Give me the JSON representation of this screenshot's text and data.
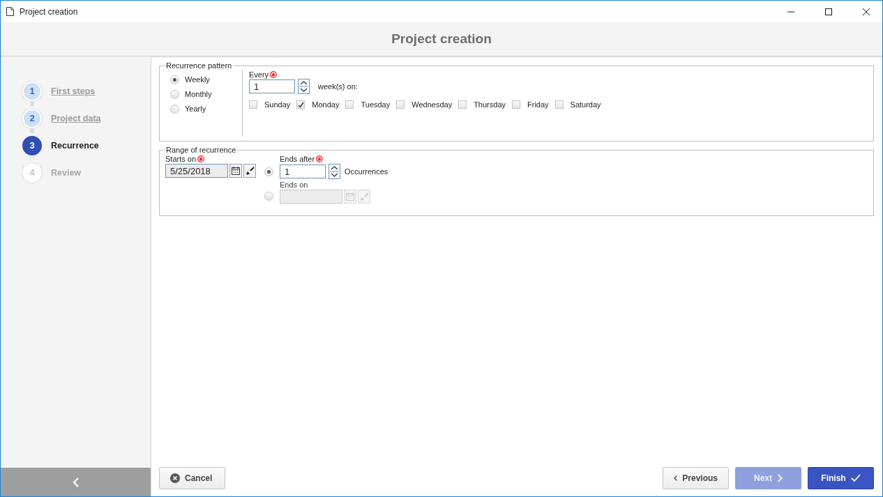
{
  "window": {
    "title": "Project creation"
  },
  "header": {
    "title": "Project creation"
  },
  "steps": [
    {
      "number": "1",
      "label": "First steps",
      "completed": true,
      "selected": false
    },
    {
      "number": "2",
      "label": "Project data",
      "completed": true,
      "selected": false
    },
    {
      "number": "3",
      "label": "Recurrence",
      "completed": false,
      "selected": true
    },
    {
      "number": "4",
      "label": "Review",
      "completed": false,
      "selected": false
    }
  ],
  "recurrence_pattern": {
    "legend": "Recurrence pattern",
    "options": [
      {
        "label": "Weekly",
        "selected": true
      },
      {
        "label": "Monthly",
        "selected": false
      },
      {
        "label": "Yearly",
        "selected": false
      }
    ],
    "every": {
      "label": "Every",
      "value": "1",
      "unit": "week(s) on:"
    },
    "days": [
      {
        "label": "Sunday",
        "checked": false
      },
      {
        "label": "Monday",
        "checked": true
      },
      {
        "label": "Tuesday",
        "checked": false
      },
      {
        "label": "Wednesday",
        "checked": false
      },
      {
        "label": "Thursday",
        "checked": false
      },
      {
        "label": "Friday",
        "checked": false
      },
      {
        "label": "Saturday",
        "checked": false
      }
    ]
  },
  "range": {
    "legend": "Range of recurrence",
    "starts_on": {
      "label": "Starts on",
      "value": "5/25/2018"
    },
    "ends_after": {
      "label": "Ends after",
      "value": "1",
      "unit": "Occurrences",
      "selected": true
    },
    "ends_on": {
      "label": "Ends on",
      "selected": false,
      "disabled": true
    }
  },
  "buttons": {
    "cancel": "Cancel",
    "previous": "Previous",
    "next": {
      "label": "Next",
      "disabled": true
    },
    "finish": "Finish"
  }
}
